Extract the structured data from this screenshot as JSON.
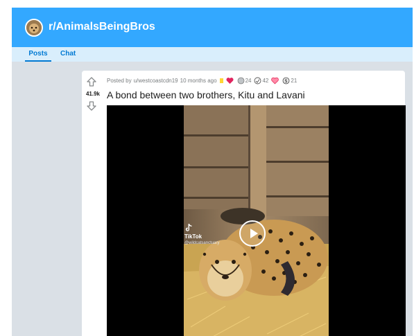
{
  "subreddit": {
    "name": "r/AnimalsBeingBros"
  },
  "tabs": [
    {
      "label": "Posts",
      "active": true
    },
    {
      "label": "Chat",
      "active": false
    }
  ],
  "post": {
    "score": "41.9k",
    "meta": {
      "posted_by_prefix": "Posted by",
      "author": "u/westcoastcdn19",
      "time": "10 months ago"
    },
    "awards": [
      {
        "icon": "gold-award-icon",
        "count": ""
      },
      {
        "icon": "heart-eyes-award-icon",
        "count": ""
      },
      {
        "icon": "silver-award-icon",
        "count": "24"
      },
      {
        "icon": "helpful-award-icon",
        "count": "42"
      },
      {
        "icon": "wholesome-award-icon",
        "count": ""
      },
      {
        "icon": "dollar-award-icon",
        "count": "21"
      }
    ],
    "title": "A bond between two brothers, Kitu and Lavani",
    "video": {
      "watermark": "TikTok",
      "watermark_user": "@wildcatsanctuary"
    }
  },
  "colors": {
    "banner": "#33a8ff",
    "tab_bar": "#d9eefc",
    "accent": "#0079d3",
    "background": "#dae0e6"
  }
}
